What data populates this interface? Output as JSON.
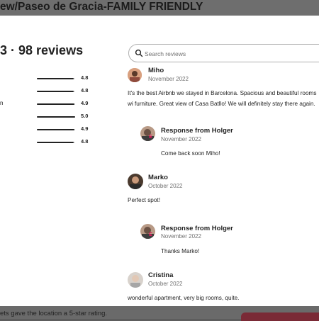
{
  "background": {
    "listing_title": "ew/Paseo de Gracia-FAMILY FRIENDLY",
    "footer_text": "ets gave the location a 5-star rating."
  },
  "summary": {
    "title": "3 · 98 reviews",
    "category_fragment": "n",
    "ratings": [
      {
        "value": "4.8",
        "fraction": 0.96
      },
      {
        "value": "4.8",
        "fraction": 0.96
      },
      {
        "value": "4.9",
        "fraction": 0.98
      },
      {
        "value": "5.0",
        "fraction": 1.0
      },
      {
        "value": "4.9",
        "fraction": 0.98
      },
      {
        "value": "4.8",
        "fraction": 0.96
      }
    ]
  },
  "search": {
    "placeholder": "Search reviews"
  },
  "reviews": [
    {
      "name": "Miho",
      "date": "November 2022",
      "text": "It's the best Airbnb we stayed in Barcelona. Spacious and beautiful rooms wi furniture. Great view of Casa Batllo! We will definitely stay there again.",
      "response": {
        "title": "Response from Holger",
        "date": "November 2022",
        "text": "Come back soon Miho!"
      }
    },
    {
      "name": "Marko",
      "date": "October 2022",
      "text": "Perfect spot!",
      "response": {
        "title": "Response from Holger",
        "date": "November 2022",
        "text": "Thanks Marko!"
      }
    },
    {
      "name": "Cristina",
      "date": "October 2022",
      "text": "wonderful apartment, very big rooms, quite."
    }
  ],
  "colors": {
    "accent": "#e31c5f",
    "text": "#222222",
    "muted": "#717171",
    "bar": "#222222"
  }
}
